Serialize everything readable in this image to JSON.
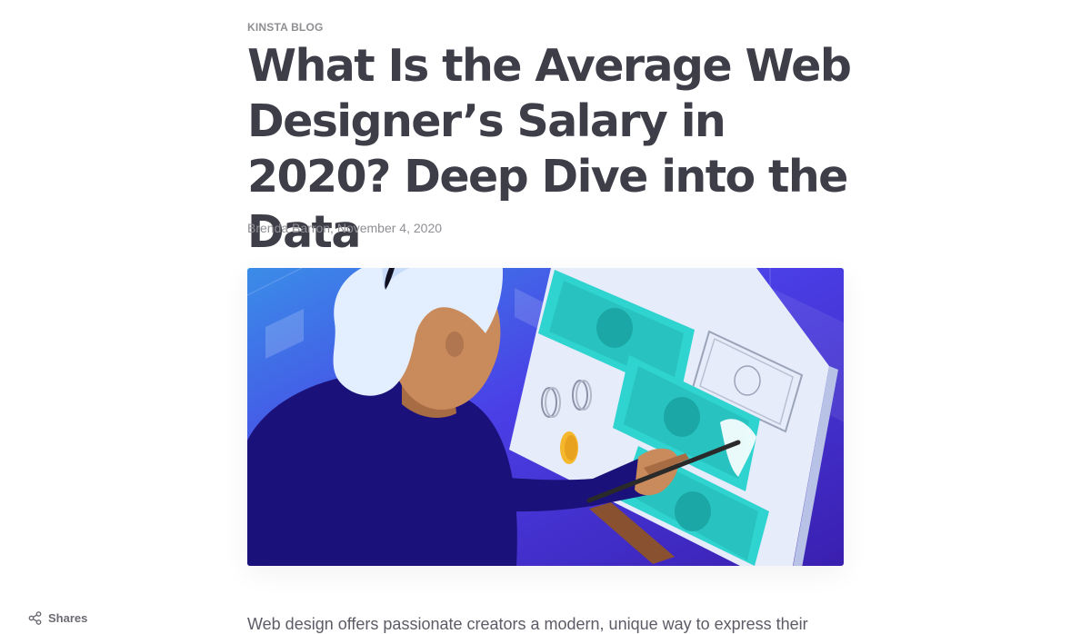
{
  "article": {
    "kicker": "KINSTA BLOG",
    "title": "What Is the Average Web Designer’s Salary in 2020? Deep Dive into the Data",
    "author": "Brenda Barron",
    "date": "November 4, 2020",
    "byline": "Brenda Barron, November 4, 2020",
    "lead_text": "Web design offers passionate creators a modern, unique way to express their"
  },
  "share_widget": {
    "label": "Shares",
    "icon": "share-icon"
  },
  "hero_image": {
    "icon": "hero-illustration",
    "colors": {
      "background_start": "#3a8de8",
      "background_end": "#3a1fb0",
      "bill": "#2fd3d0",
      "skin": "#c98a5c",
      "hair": "#e3efff",
      "shirt": "#1b117a",
      "coin": "#f5b72b"
    }
  },
  "theme": {
    "title_color": "#3e3e49",
    "muted_color": "#8f8f94"
  }
}
